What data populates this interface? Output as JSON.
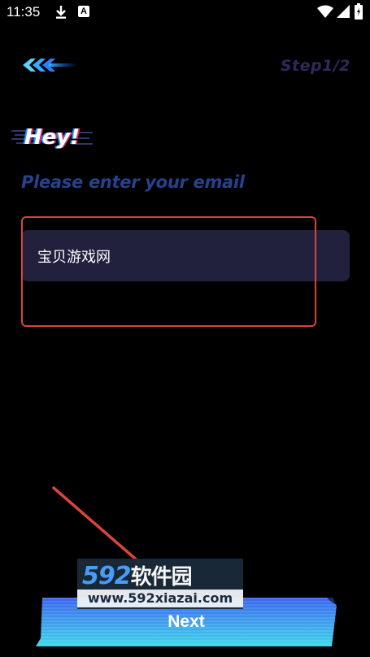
{
  "status_bar": {
    "time": "11:35",
    "icons": [
      "download-icon",
      "a-badge-icon",
      "wifi-icon",
      "signal-icon",
      "battery-icon"
    ],
    "a_badge": "A"
  },
  "header": {
    "logo_icon": "speed-arrows-logo",
    "step": "Step1/2"
  },
  "greeting": {
    "title": "Hey!",
    "prompt": "Please enter your email"
  },
  "email_field": {
    "value": "宝贝游戏网"
  },
  "next_button": {
    "label": "Next"
  },
  "watermark": {
    "brand_number": "592",
    "brand_cn": "软件园",
    "url": "www.592xiazai.com"
  },
  "colors": {
    "background": "#000000",
    "input_bg": "#21203d",
    "prompt": "#25428f",
    "step": "#2c2a5a",
    "button_gradient": [
      "#3a6cf0",
      "#3fd0e8"
    ],
    "annotation": "#d9453a"
  }
}
